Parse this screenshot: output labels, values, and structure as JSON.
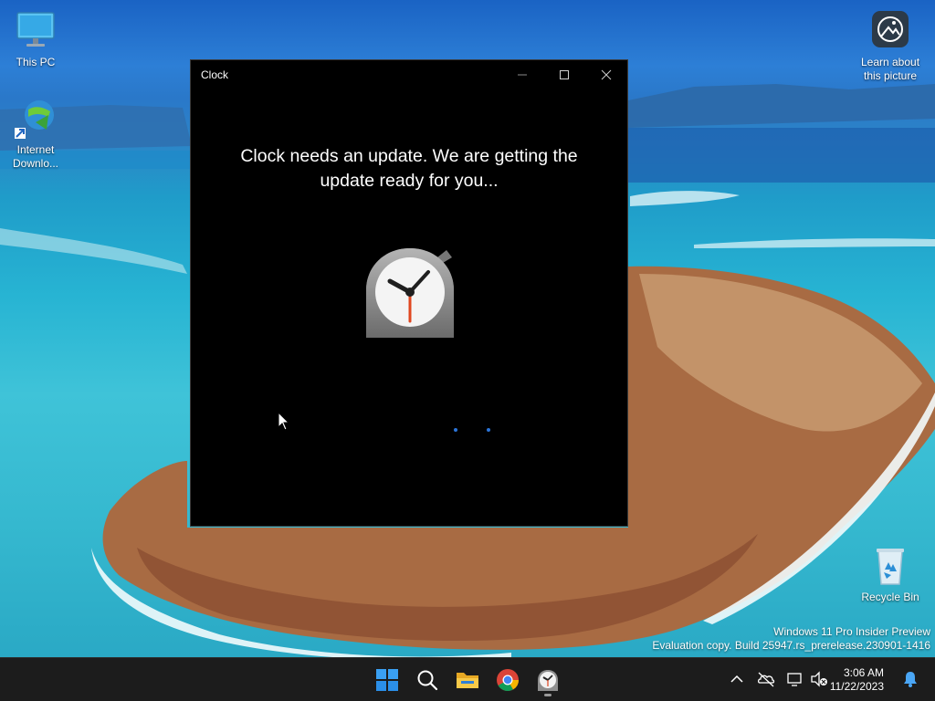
{
  "desktop": {
    "icons": [
      {
        "label": "This PC"
      },
      {
        "label": "Internet Downlo..."
      },
      {
        "label": "Learn about this picture"
      },
      {
        "label": "Recycle Bin"
      }
    ],
    "watermark": {
      "line1": "Windows 11 Pro Insider Preview",
      "line2": "Evaluation copy. Build 25947.rs_prerelease.230901-1416"
    }
  },
  "window": {
    "title": "Clock",
    "message": "Clock needs an update. We are getting the update ready for you..."
  },
  "taskbar": {
    "apps": [
      {
        "icon": "windows-start-icon"
      },
      {
        "icon": "search-icon"
      },
      {
        "icon": "file-explorer-icon"
      },
      {
        "icon": "chrome-icon"
      },
      {
        "icon": "clock-app-icon"
      }
    ],
    "time": "3:06 AM",
    "date": "11/22/2023"
  },
  "colors": {
    "accent": "#2b74d8",
    "taskbar_bg": "#1c1c1c",
    "window_bg": "#000000"
  }
}
